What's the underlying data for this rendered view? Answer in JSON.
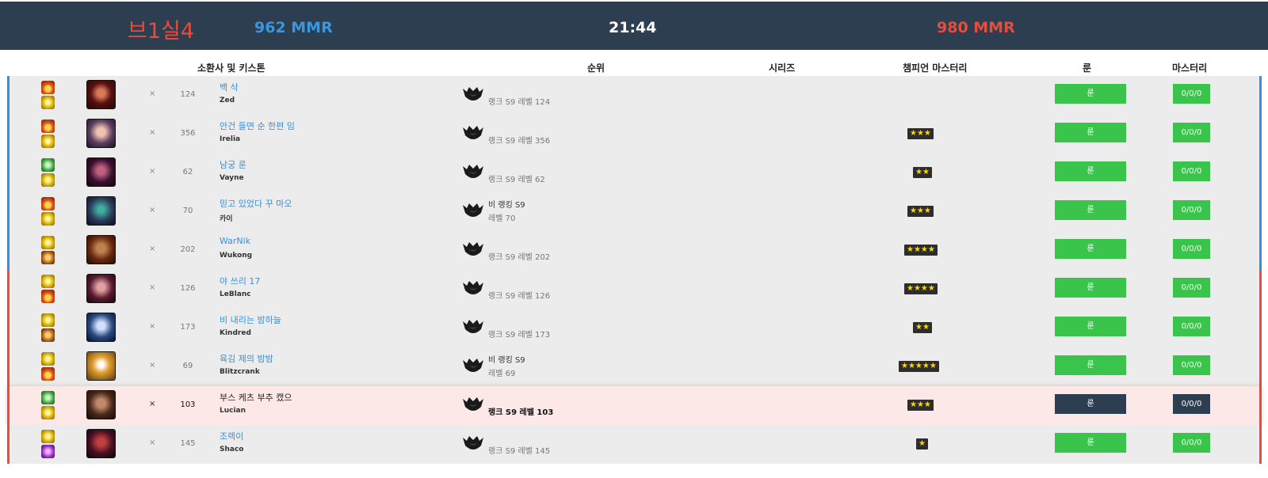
{
  "topbar": {
    "tier": "브1실4",
    "blue_mmr": "962 MMR",
    "timer": "21:44",
    "red_mmr": "980 MMR"
  },
  "columns": {
    "summoner": "소환사 및 키스톤",
    "rank": "순위",
    "series": "시리즈",
    "mastery": "챔피언 마스터리",
    "runes": "룬",
    "masteries": "마스터리"
  },
  "colors": {
    "blue_team": "#3a8fd8",
    "red_team": "#e74c3c",
    "button_green": "#3bc44b",
    "header_bg": "#2c3e50",
    "self_bg": "#fde8e8"
  },
  "players": [
    {
      "team": "blue",
      "spells": [
        "ignite-icon",
        "flash-icon"
      ],
      "champion_icon": "zed-portrait-icon",
      "close": "×",
      "level": "124",
      "summoner": "백 삭",
      "champion": "Zed",
      "rank_line1": "랭크 S9 레벨 124",
      "rank_line2": "",
      "mastery_stars": "",
      "rune_label": "룬",
      "mastery_label": "0/0/0"
    },
    {
      "team": "blue",
      "spells": [
        "ignite-icon",
        "flash-icon"
      ],
      "champion_icon": "irelia-portrait-icon",
      "close": "×",
      "level": "356",
      "summoner": "안건 들면 순 한편 임",
      "champion": "Irelia",
      "rank_line1": "랭크 S9 레벨 356",
      "rank_line2": "",
      "mastery_stars": "★★★",
      "rune_label": "룬",
      "mastery_label": "0/0/0"
    },
    {
      "team": "blue",
      "spells": [
        "heal-icon",
        "flash-icon"
      ],
      "champion_icon": "vayne-portrait-icon",
      "close": "×",
      "level": "62",
      "summoner": "남궁 룬",
      "champion": "Vayne",
      "rank_line1": "랭크 S9 레벨 62",
      "rank_line2": "",
      "mastery_stars": "★★",
      "rune_label": "룬",
      "mastery_label": "0/0/0"
    },
    {
      "team": "blue",
      "spells": [
        "ignite-icon",
        "flash-icon"
      ],
      "champion_icon": "kaisa-portrait-icon",
      "close": "×",
      "level": "70",
      "summoner": "믿고 있었다 꾸 마오",
      "champion": "카이",
      "rank_line1": "비 랭킹 S9",
      "rank_line2": "레벨 70",
      "mastery_stars": "★★★",
      "rune_label": "룬",
      "mastery_label": "0/0/0"
    },
    {
      "team": "blue",
      "spells": [
        "flash-icon",
        "smite-icon"
      ],
      "champion_icon": "wukong-portrait-icon",
      "close": "×",
      "level": "202",
      "summoner": "WarNik",
      "champion": "Wukong",
      "rank_line1": "랭크 S9 레벨 202",
      "rank_line2": "",
      "mastery_stars": "★★★★",
      "rune_label": "룬",
      "mastery_label": "0/0/0"
    },
    {
      "team": "red",
      "spells": [
        "flash-icon",
        "ignite-icon"
      ],
      "champion_icon": "leblanc-portrait-icon",
      "close": "×",
      "level": "126",
      "summoner": "야 쓰리 17",
      "champion": "LeBlanc",
      "rank_line1": "랭크 S9 레벨 126",
      "rank_line2": "",
      "mastery_stars": "★★★★",
      "rune_label": "룬",
      "mastery_label": "0/0/0"
    },
    {
      "team": "red",
      "spells": [
        "flash-icon",
        "smite-icon"
      ],
      "champion_icon": "kindred-portrait-icon",
      "close": "×",
      "level": "173",
      "summoner": "비 내리는 밤하늘",
      "champion": "Kindred",
      "rank_line1": "랭크 S9 레벨 173",
      "rank_line2": "",
      "mastery_stars": "★★",
      "rune_label": "룬",
      "mastery_label": "0/0/0"
    },
    {
      "team": "red",
      "spells": [
        "flash-icon",
        "ignite-icon"
      ],
      "champion_icon": "blitzcrank-portrait-icon",
      "close": "×",
      "level": "69",
      "summoner": "육김 제의 밤밤",
      "champion": "Blitzcrank",
      "rank_line1": "비 랭킹 S9",
      "rank_line2": "레벨 69",
      "mastery_stars": "★★★★★",
      "rune_label": "룬",
      "mastery_label": "0/0/0"
    },
    {
      "team": "red",
      "self": true,
      "spells": [
        "heal-icon",
        "flash-icon"
      ],
      "champion_icon": "lucian-portrait-icon",
      "close": "×",
      "level": "103",
      "summoner": "부스 케츠 부추 캤으",
      "champion": "Lucian",
      "rank_line1": "랭크 S9 레벨 103",
      "rank_line2": "",
      "mastery_stars": "★★★",
      "rune_label": "룬",
      "mastery_label": "0/0/0"
    },
    {
      "team": "red",
      "spells": [
        "flash-icon",
        "teleport-icon"
      ],
      "champion_icon": "shaco-portrait-icon",
      "close": "×",
      "level": "145",
      "summoner": "조렉이",
      "champion": "Shaco",
      "rank_line1": "랭크 S9 레벨 145",
      "rank_line2": "",
      "mastery_stars": "★",
      "rune_label": "룬",
      "mastery_label": "0/0/0"
    }
  ]
}
